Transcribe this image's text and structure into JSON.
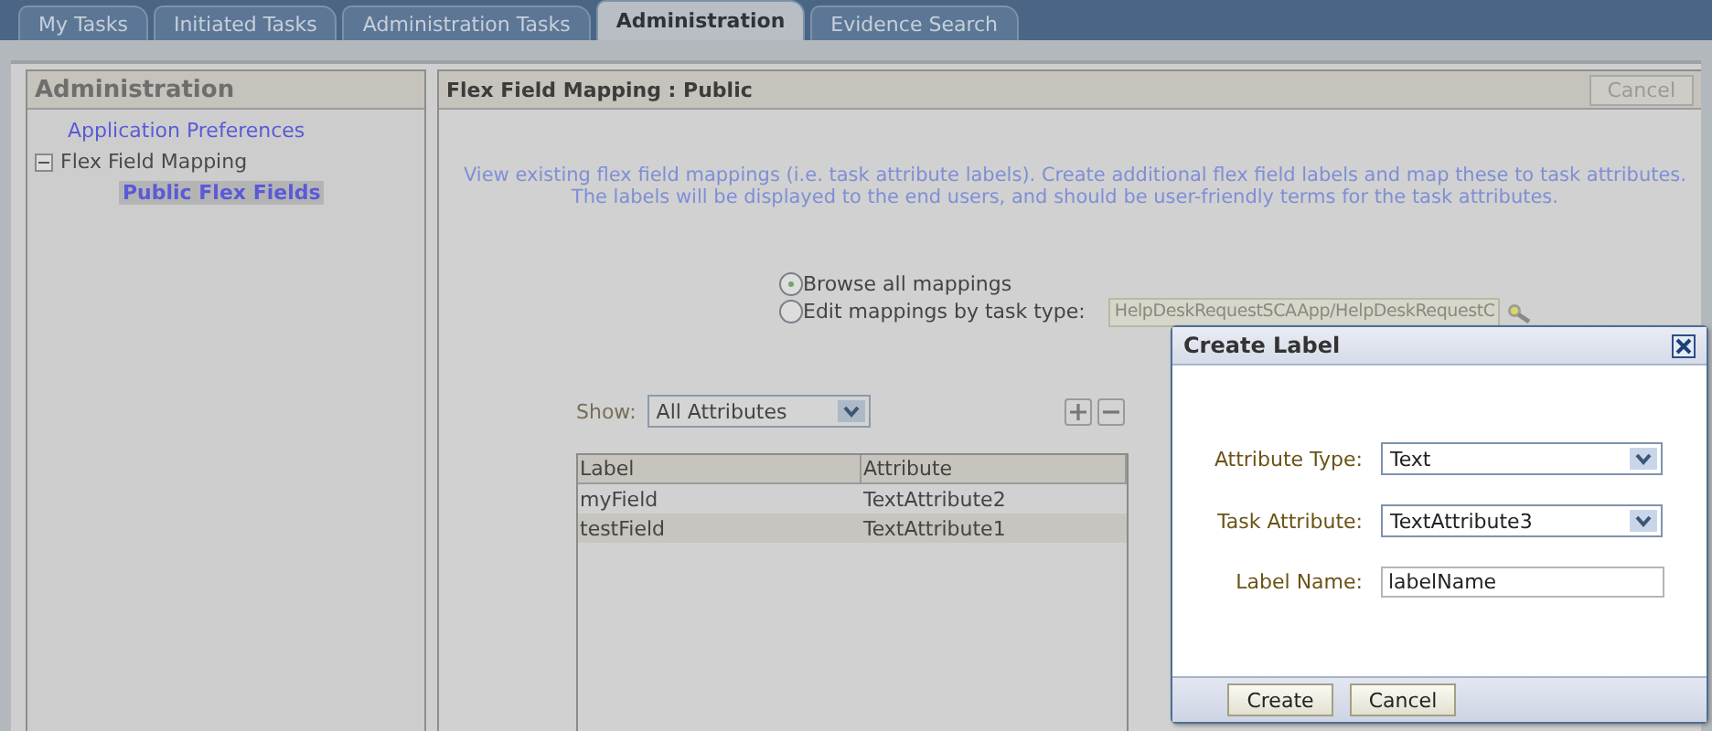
{
  "tabs": [
    {
      "label": "My Tasks",
      "selected": false
    },
    {
      "label": "Initiated Tasks",
      "selected": false
    },
    {
      "label": "Administration Tasks",
      "selected": false
    },
    {
      "label": "Administration",
      "selected": true
    },
    {
      "label": "Evidence Search",
      "selected": false
    }
  ],
  "sidebar": {
    "title": "Administration",
    "items": [
      {
        "label": "Application Preferences",
        "selected": false
      },
      {
        "label": "Flex Field Mapping",
        "selected": false,
        "expanded": true,
        "children": [
          {
            "label": "Public Flex Fields",
            "selected": true
          }
        ]
      }
    ]
  },
  "main": {
    "title": "Flex Field Mapping : Public",
    "cancel_button": "Cancel",
    "description": [
      "View existing flex field mappings (i.e. task attribute labels). Create additional flex field labels and map these to task attributes.",
      "The labels will be displayed to the end users, and should be user-friendly terms for the task attributes."
    ],
    "radios": [
      {
        "label": "Browse all mappings",
        "selected": true
      },
      {
        "label": "Edit mappings by task type:",
        "selected": false
      }
    ],
    "task_type_field": {
      "value": "HelpDeskRequestSCAApp/HelpDeskRequestC",
      "disabled": true
    },
    "show": {
      "label": "Show:",
      "value": "All Attributes"
    },
    "table": {
      "columns": [
        "Label",
        "Attribute"
      ],
      "rows": [
        {
          "cells": [
            "myField",
            "TextAttribute2"
          ],
          "selected": false
        },
        {
          "cells": [
            "testField",
            "TextAttribute1"
          ],
          "selected": true
        }
      ]
    }
  },
  "dialog": {
    "title": "Create Label",
    "fields": [
      {
        "label": "Attribute Type:",
        "kind": "select",
        "value": "Text"
      },
      {
        "label": "Task Attribute:",
        "kind": "select",
        "value": "TextAttribute3"
      },
      {
        "label": "Label Name:",
        "kind": "text",
        "value": "labelName"
      }
    ],
    "buttons": [
      "Create",
      "Cancel"
    ]
  }
}
